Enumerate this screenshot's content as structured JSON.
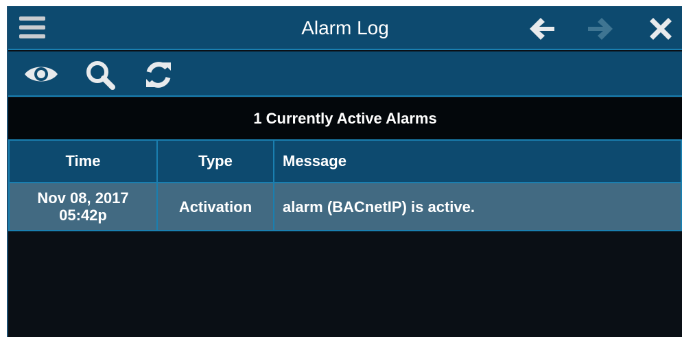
{
  "window": {
    "title": "Alarm Log",
    "icons": {
      "menu": "hamburger-menu-icon",
      "back": "arrow-left-icon",
      "forward": "arrow-right-icon",
      "close": "close-icon"
    }
  },
  "toolbar": {
    "icons": [
      "eye-icon",
      "search-icon",
      "refresh-icon"
    ]
  },
  "summary": {
    "text": "1 Currently Active Alarms"
  },
  "table": {
    "columns": [
      "Time",
      "Type",
      "Message"
    ],
    "rows": [
      {
        "time_date": "Nov 08, 2017",
        "time_clock": "05:42p",
        "type": "Activation",
        "message": "alarm (BACnetIP) is active."
      }
    ]
  },
  "colors": {
    "header_bg": "#0d4a6f",
    "border_accent": "#1a7fb0",
    "row_bg": "#426a82",
    "background": "#0a0f15",
    "forward_disabled": "#3f7592"
  }
}
